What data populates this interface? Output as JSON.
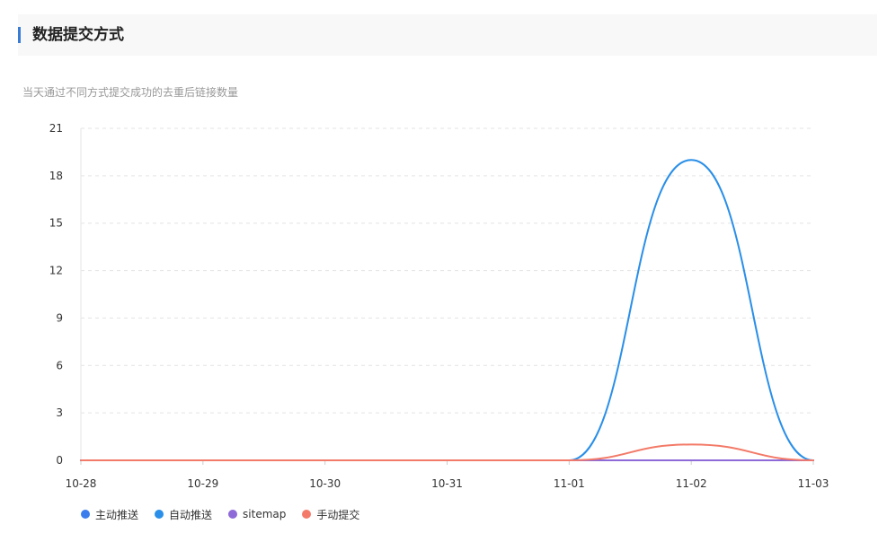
{
  "header": {
    "title": "数据提交方式"
  },
  "chart_data": {
    "type": "line",
    "subtitle": "当天通过不同方式提交成功的去重后链接数量",
    "categories": [
      "10-28",
      "10-29",
      "10-30",
      "10-31",
      "11-01",
      "11-02",
      "11-03"
    ],
    "ylim": [
      0,
      21
    ],
    "yticks": [
      "0",
      "3",
      "6",
      "9",
      "12",
      "15",
      "18",
      "21"
    ],
    "grid": true,
    "legend_position": "bottom-left",
    "series": [
      {
        "name": "主动推送",
        "color": "#3b7ded",
        "values": [
          0,
          0,
          0,
          0,
          0,
          0,
          0
        ]
      },
      {
        "name": "自动推送",
        "color": "#2a8fe8",
        "values": [
          0,
          0,
          0,
          0,
          0,
          19,
          0
        ]
      },
      {
        "name": "sitemap",
        "color": "#8d6ad8",
        "values": [
          0,
          0,
          0,
          0,
          0,
          0,
          0
        ]
      },
      {
        "name": "手动提交",
        "color": "#f37a68",
        "values": [
          0,
          0,
          0,
          0,
          0,
          1,
          0
        ]
      }
    ]
  }
}
